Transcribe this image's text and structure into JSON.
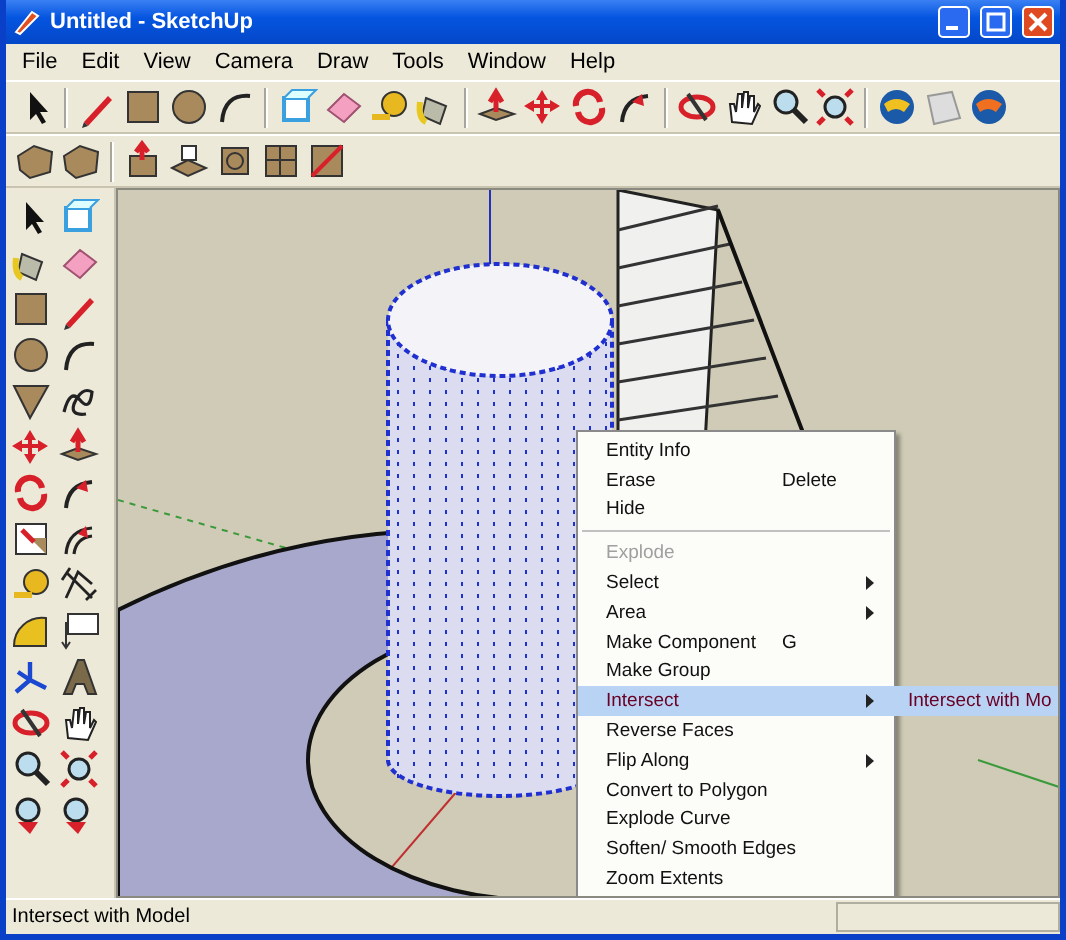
{
  "window": {
    "title": "Untitled - SketchUp"
  },
  "menu_bar": [
    "File",
    "Edit",
    "View",
    "Camera",
    "Draw",
    "Tools",
    "Window",
    "Help"
  ],
  "context_menu": {
    "sections": [
      [
        {
          "label": "Entity Info",
          "disabled": false,
          "selected": false,
          "has_submenu": false
        },
        {
          "label": "Erase",
          "shortcut": "Delete",
          "disabled": false,
          "selected": false,
          "has_submenu": false
        },
        {
          "label": "Hide",
          "disabled": false,
          "selected": false,
          "has_submenu": false
        }
      ],
      [
        {
          "label": "Explode",
          "disabled": true,
          "selected": false,
          "has_submenu": false
        },
        {
          "label": "Select",
          "disabled": false,
          "selected": false,
          "has_submenu": true
        },
        {
          "label": "Area",
          "disabled": false,
          "selected": false,
          "has_submenu": true
        },
        {
          "label": "Make Component",
          "shortcut": "G",
          "disabled": false,
          "selected": false,
          "has_submenu": false
        },
        {
          "label": "Make Group",
          "disabled": false,
          "selected": false,
          "has_submenu": false
        },
        {
          "label": "Intersect",
          "disabled": false,
          "selected": true,
          "has_submenu": true
        },
        {
          "label": "Reverse Faces",
          "disabled": false,
          "selected": false,
          "has_submenu": false
        },
        {
          "label": "Flip Along",
          "disabled": false,
          "selected": false,
          "has_submenu": true
        },
        {
          "label": "Convert to Polygon",
          "disabled": false,
          "selected": false,
          "has_submenu": false
        },
        {
          "label": "Explode Curve",
          "disabled": false,
          "selected": false,
          "has_submenu": false
        },
        {
          "label": "Soften/ Smooth Edges",
          "disabled": false,
          "selected": false,
          "has_submenu": false
        },
        {
          "label": "Zoom Extents",
          "disabled": false,
          "selected": false,
          "has_submenu": false
        }
      ]
    ],
    "submenu": {
      "items": [
        "Intersect with Mo"
      ]
    }
  },
  "status_bar": {
    "text": "Intersect with Model"
  }
}
